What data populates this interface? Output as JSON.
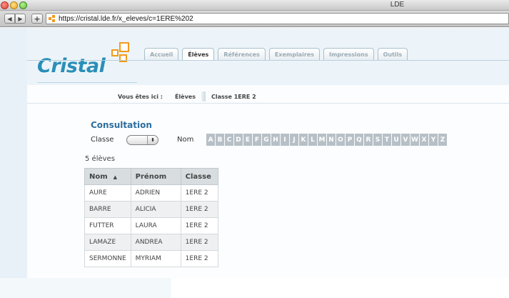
{
  "window": {
    "title": "LDE"
  },
  "browser": {
    "url": "https://cristal.lde.fr/x_eleves/c=1ERE%202"
  },
  "app": {
    "logo_text": "Cristal",
    "tabs": [
      {
        "label": "Accueil",
        "active": false
      },
      {
        "label": "Élèves",
        "active": true
      },
      {
        "label": "Références",
        "active": false
      },
      {
        "label": "Exemplaires",
        "active": false
      },
      {
        "label": "Impressions",
        "active": false
      },
      {
        "label": "Outils",
        "active": false
      }
    ],
    "accent_color": "#2a8fb8",
    "logo_mark_color": "#f29a1b"
  },
  "breadcrumb": {
    "label": "Vous êtes ici :",
    "items": [
      "Élèves",
      "Classe 1ERE 2"
    ]
  },
  "consultation": {
    "title": "Consultation",
    "classe_label": "Classe",
    "classe_value": "",
    "nom_label": "Nom",
    "letters": [
      "A",
      "B",
      "C",
      "D",
      "E",
      "F",
      "G",
      "H",
      "I",
      "J",
      "K",
      "L",
      "M",
      "N",
      "O",
      "P",
      "Q",
      "R",
      "S",
      "T",
      "U",
      "V",
      "W",
      "X",
      "Y",
      "Z"
    ],
    "count_text": "5 élèves"
  },
  "table": {
    "headers": [
      "Nom",
      "Prénom",
      "Classe"
    ],
    "sort_indicator": "▲",
    "rows": [
      [
        "AURE",
        "ADRIEN",
        "1ERE 2"
      ],
      [
        "BARRE",
        "ALICIA",
        "1ERE 2"
      ],
      [
        "FUTTER",
        "LAURA",
        "1ERE 2"
      ],
      [
        "LAMAZE",
        "ANDREA",
        "1ERE 2"
      ],
      [
        "SERMONNE",
        "MYRIAM",
        "1ERE 2"
      ]
    ]
  }
}
